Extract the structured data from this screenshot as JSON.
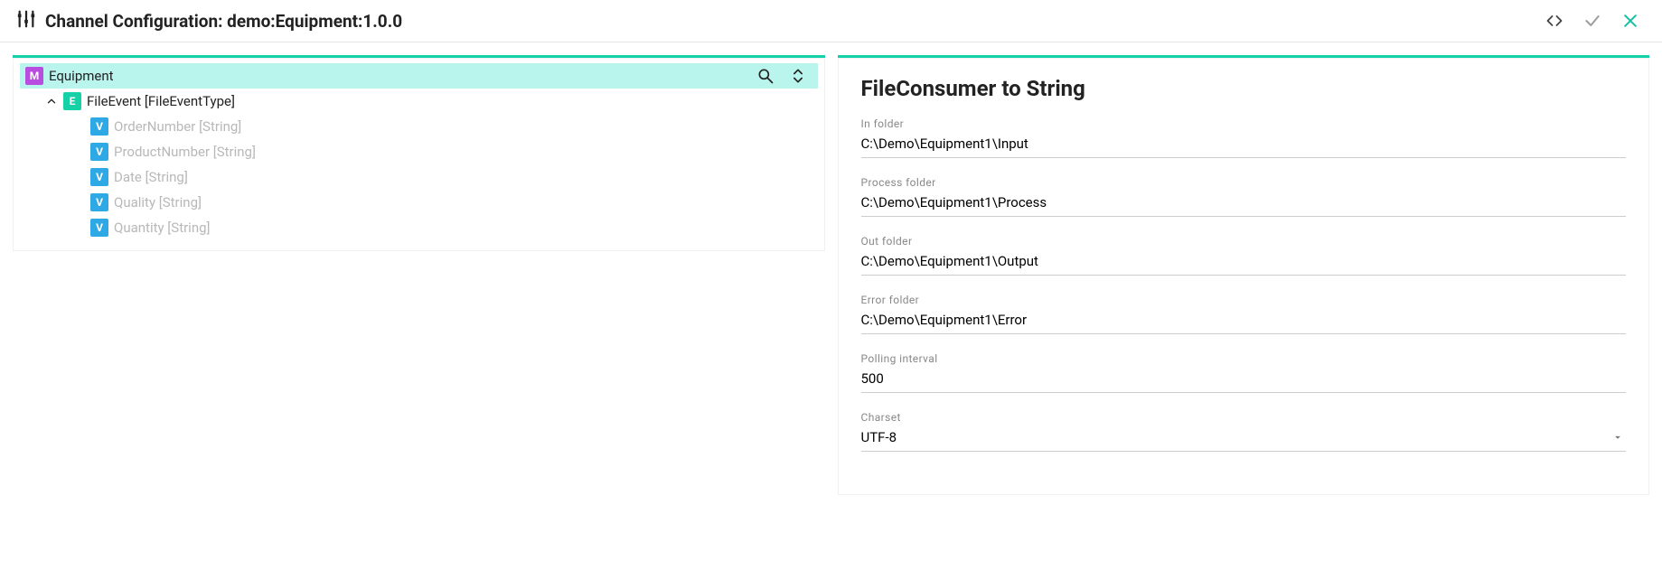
{
  "header": {
    "title": "Channel Configuration: demo:Equipment:1.0.0"
  },
  "tree": {
    "root": {
      "badge": "M",
      "label": "Equipment"
    },
    "event": {
      "badge": "E",
      "label": "FileEvent [FileEventType]"
    },
    "vars": [
      {
        "label": "OrderNumber [String]"
      },
      {
        "label": "ProductNumber [String]"
      },
      {
        "label": "Date [String]"
      },
      {
        "label": "Quality [String]"
      },
      {
        "label": "Quantity [String]"
      }
    ],
    "varBadge": "V"
  },
  "form": {
    "title": "FileConsumer to String",
    "fields": {
      "in_folder": {
        "label": "In folder",
        "value": "C:\\Demo\\Equipment1\\Input"
      },
      "process_folder": {
        "label": "Process folder",
        "value": "C:\\Demo\\Equipment1\\Process"
      },
      "out_folder": {
        "label": "Out folder",
        "value": "C:\\Demo\\Equipment1\\Output"
      },
      "error_folder": {
        "label": "Error folder",
        "value": "C:\\Demo\\Equipment1\\Error"
      },
      "polling_interval": {
        "label": "Polling interval",
        "value": "500"
      },
      "charset": {
        "label": "Charset",
        "value": "UTF-8"
      }
    }
  }
}
